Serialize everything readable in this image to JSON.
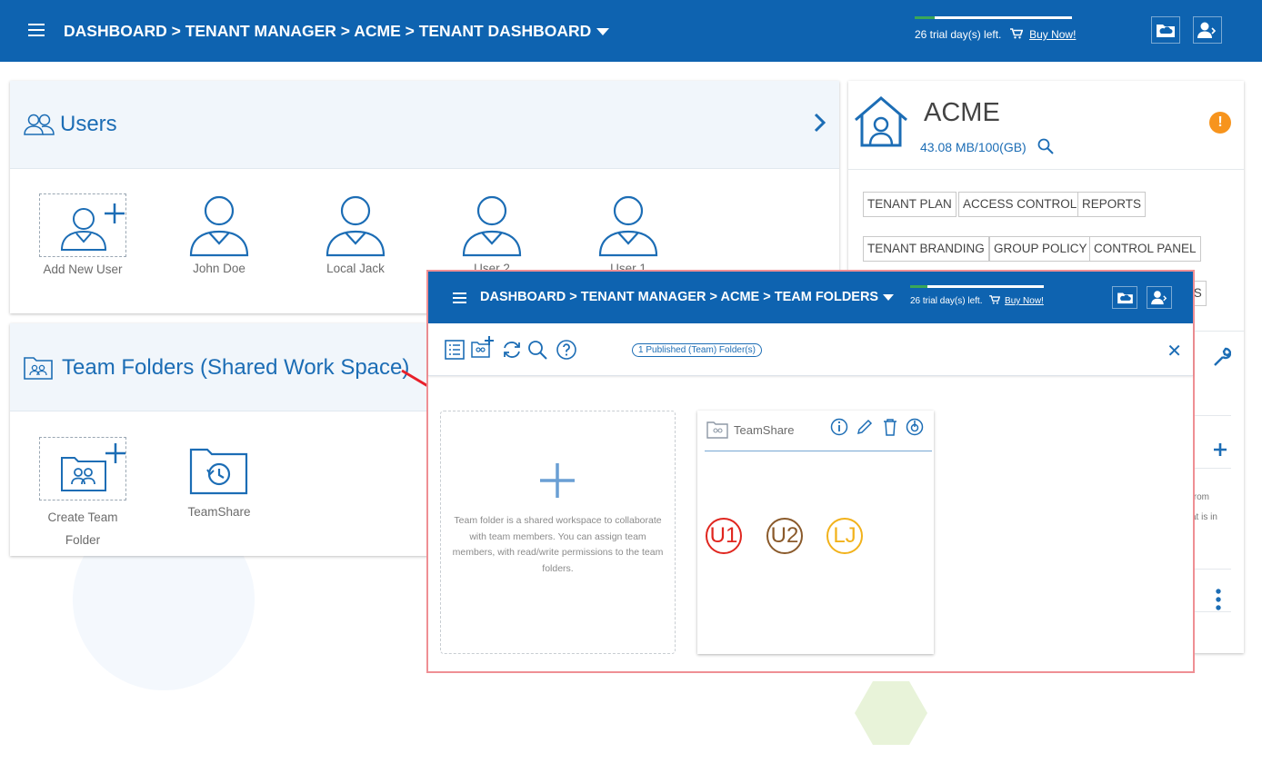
{
  "header": {
    "breadcrumb": "DASHBOARD > TENANT MANAGER > ACME > TENANT DASHBOARD",
    "trial_text": "26 trial day(s) left.",
    "buy_now": "Buy Now!",
    "trial_progress": 0.13
  },
  "users_panel": {
    "title": "Users",
    "items": [
      {
        "label": "Add New User"
      },
      {
        "label": "John Doe"
      },
      {
        "label": "Local Jack"
      },
      {
        "label": "User 2"
      },
      {
        "label": "User 1"
      }
    ]
  },
  "team_folders_panel": {
    "title": "Team Folders (Shared Work Space)",
    "items": [
      {
        "label_line1": "Create Team",
        "label_line2": "Folder"
      },
      {
        "label": "TeamShare"
      }
    ]
  },
  "tenant": {
    "name": "ACME",
    "storage": "43.08 MB/100(GB)",
    "warning": "!",
    "buttons": [
      "TENANT PLAN",
      "ACCESS CONTROL",
      "REPORTS",
      "TENANT BRANDING",
      "GROUP POLICY",
      "CONTROL PANEL"
    ],
    "partial_button": "ERS",
    "snippet_line1": "from",
    "snippet_line2": "at is in"
  },
  "overlay": {
    "breadcrumb": "DASHBOARD > TENANT MANAGER > ACME > TEAM FOLDERS",
    "trial_text": "26 trial day(s) left.",
    "buy_now": "Buy Now!",
    "published_pill": "1 Published (Team) Folder(s)",
    "new_folder_description": "Team folder is a shared workspace to collaborate with team members. You can assign team members, with read/write permissions to the team folders.",
    "teamshare": {
      "name": "TeamShare",
      "members": [
        {
          "initials": "U1",
          "color": "#e0261f"
        },
        {
          "initials": "U2",
          "color": "#8a5a2b"
        },
        {
          "initials": "LJ",
          "color": "#f2b21b"
        }
      ]
    }
  },
  "colors": {
    "brand_blue": "#0e63b0",
    "accent_blue": "#1c6db5",
    "warning_orange": "#f7941d",
    "annotation_red": "#e8202a"
  }
}
